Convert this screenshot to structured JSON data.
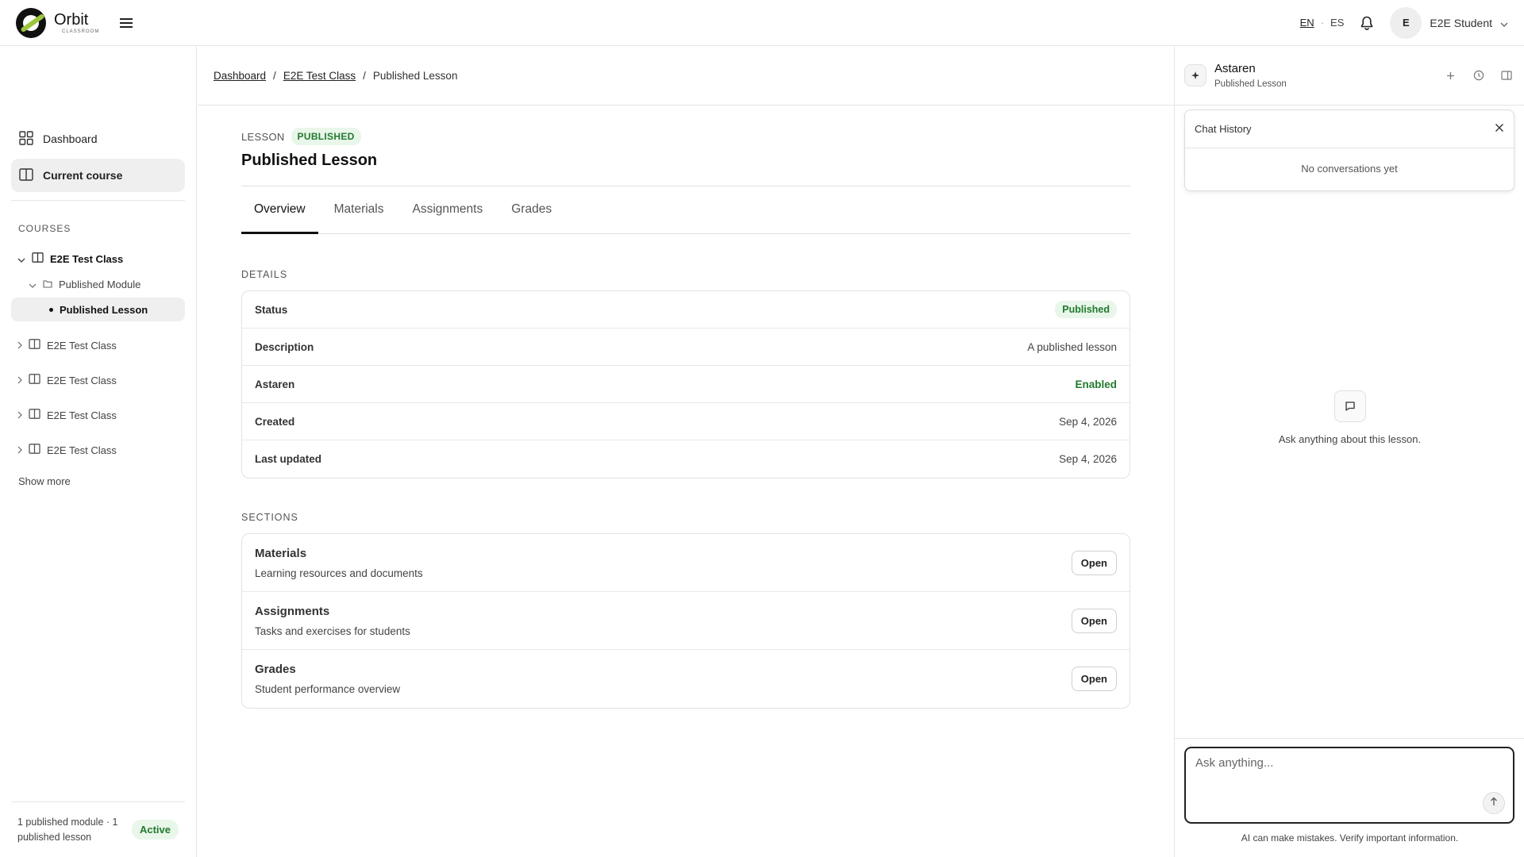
{
  "header": {
    "brand_name": "Orbit",
    "brand_sub": "CLASSROOM",
    "lang_en": "EN",
    "lang_sep": "·",
    "lang_es": "ES",
    "avatar_initial": "E",
    "user_name": "E2E Student"
  },
  "sidebar": {
    "nav": [
      {
        "label": "Dashboard",
        "icon": "dashboard-grid-icon"
      },
      {
        "label": "Current course",
        "icon": "book-icon"
      }
    ],
    "courses_label": "COURSES",
    "open_course": "E2E Test Class",
    "module": "Published Module",
    "lesson": "Published Lesson",
    "other_courses": [
      "E2E Test Class",
      "E2E Test Class",
      "E2E Test Class",
      "E2E Test Class"
    ],
    "show_more": "Show more",
    "footer_text": "1 published module · 1 published lesson",
    "footer_badge": "Active"
  },
  "breadcrumb": {
    "items": [
      "Dashboard",
      "E2E Test Class"
    ],
    "separator": "/",
    "current": "Published Lesson"
  },
  "lesson": {
    "kicker": "LESSON",
    "status_pill": "PUBLISHED",
    "title": "Published Lesson",
    "tabs": [
      "Overview",
      "Materials",
      "Assignments",
      "Grades"
    ],
    "active_tab": "Overview"
  },
  "details": {
    "label": "DETAILS",
    "rows": [
      {
        "key": "Status",
        "value": "Published"
      },
      {
        "key": "Description",
        "value": "A published lesson"
      },
      {
        "key": "Astaren",
        "value": "Enabled"
      },
      {
        "key": "Created",
        "value": "Sep 4, 2026"
      },
      {
        "key": "Last updated",
        "value": "Sep 4, 2026"
      }
    ]
  },
  "sections": {
    "label": "SECTIONS",
    "items": [
      {
        "title": "Materials",
        "desc": "Learning resources and documents",
        "button": "Open"
      },
      {
        "title": "Assignments",
        "desc": "Tasks and exercises for students",
        "button": "Open"
      },
      {
        "title": "Grades",
        "desc": "Student performance overview",
        "button": "Open"
      }
    ]
  },
  "assistant": {
    "name": "Astaren",
    "context": "Published Lesson",
    "history_title": "Chat History",
    "history_empty": "No conversations yet",
    "empty_prompt": "Ask anything about this lesson.",
    "input_placeholder": "Ask anything...",
    "disclaimer": "AI can make mistakes. Verify important information."
  },
  "colors": {
    "accent_green": "#217a2e",
    "pill_green_bg": "#e9f6ea",
    "logo_green": "#9bc53d"
  }
}
